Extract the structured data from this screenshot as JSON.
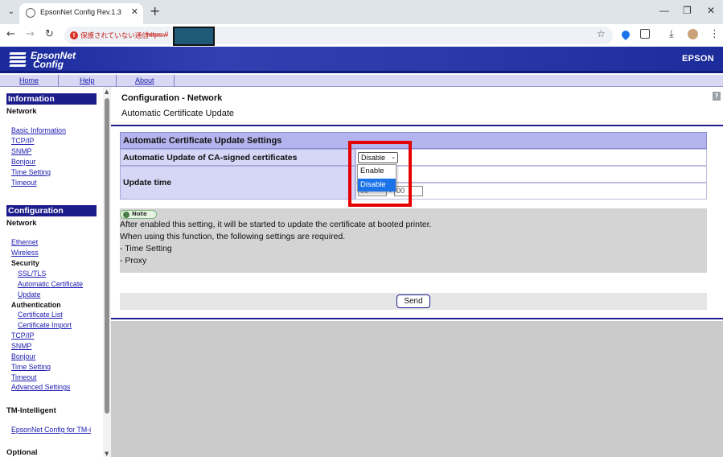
{
  "browser": {
    "tab_title": "EpsonNet Config Rev.1.3",
    "tab_close": "✕",
    "new_tab": "+",
    "security_warning": "保護されていない通信",
    "url_prefix": "https://",
    "window_minimize": "—",
    "window_restore": "❐",
    "window_close": "✕"
  },
  "header": {
    "logo_line1": "EpsonNet",
    "logo_line2": "Config",
    "brand": "EPSON"
  },
  "top_nav": {
    "home": "Home",
    "help": "Help",
    "about": "About"
  },
  "sidebar": {
    "information_title": "Information",
    "information_network": "Network",
    "information_links": [
      "Basic Information",
      "TCP/IP",
      "SNMP",
      "Bonjour",
      "Time Setting",
      "Timeout"
    ],
    "configuration_title": "Configuration",
    "configuration_network": "Network",
    "ethernet": "Ethernet",
    "wireless": "Wireless",
    "security": "Security",
    "ssl_tls": "SSL/TLS",
    "auto_cert_1": "Automatic Certificate",
    "auto_cert_2": "Update",
    "authentication": "Authentication",
    "certificate_list": "Certificate List",
    "certificate_import": "Certificate Import",
    "tcpip": "TCP/IP",
    "snmp": "SNMP",
    "bonjour": "Bonjour",
    "time_setting": "Time Setting",
    "timeout": "Timeout",
    "advanced": "Advanced Settings",
    "tm_intelligent": "TM-Intelligent",
    "epsonnet_tmi": "EpsonNet Config for TM-i",
    "optional": "Optional"
  },
  "main": {
    "title": "Configuration - Network",
    "subtitle": "Automatic Certificate Update",
    "section_header": "Automatic Certificate Update Settings",
    "auto_update_label": "Automatic Update of CA-signed certificates",
    "auto_update_value": "Disable",
    "update_time_label": "Update time",
    "hour_value": "00",
    "minute_value": "00",
    "dropdown_options": [
      "Enable",
      "Disable"
    ],
    "note_label": "Note",
    "note_lines": [
      "After enabled this setting, it will be started to update the certificate at booted printer.",
      "When using this function, the following settings are required.",
      "- Time Setting",
      "- Proxy"
    ],
    "send_button": "Send",
    "help_icon": "?"
  }
}
